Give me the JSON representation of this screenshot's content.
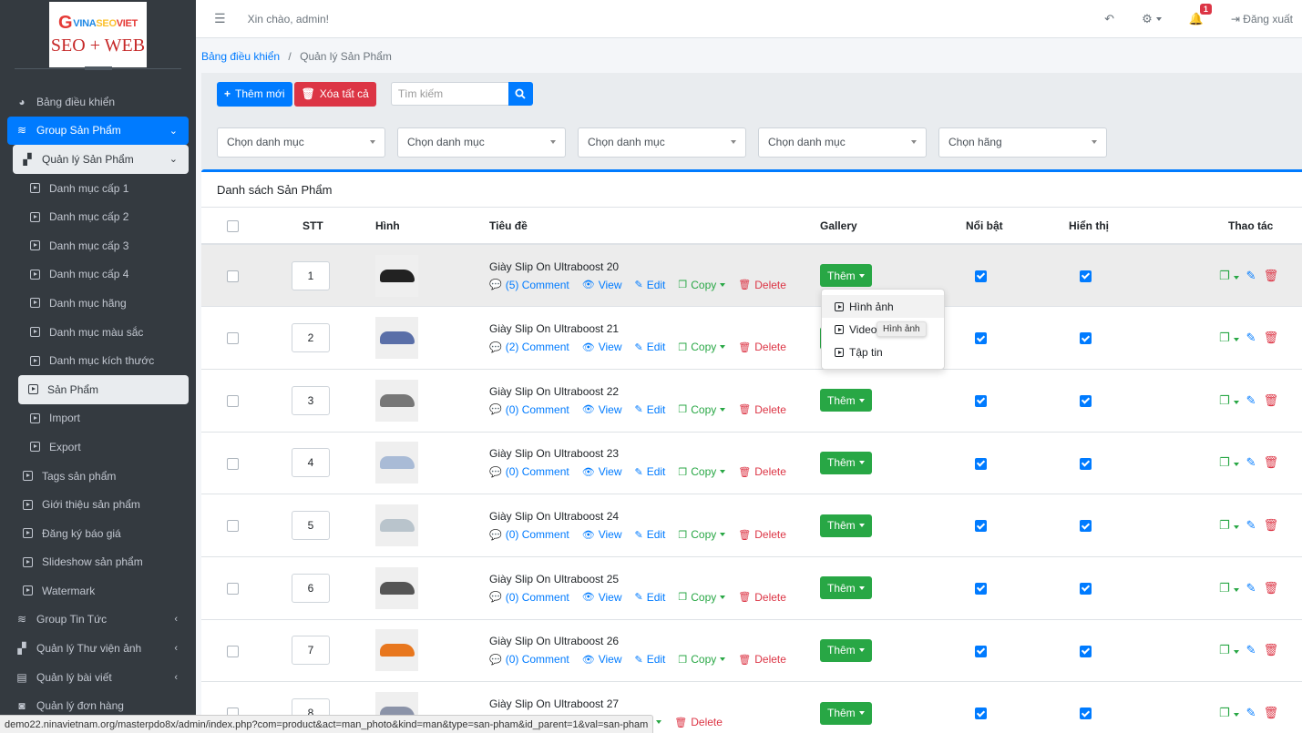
{
  "logo": {
    "top_g": "G",
    "top_a": "VINA",
    "top_b": "SEO",
    "top_c": "VIET",
    "bottom": "SEO + WEB"
  },
  "sidebar": {
    "items": [
      {
        "label": "Bảng điều khiển"
      },
      {
        "label": "Group Sản Phẩm"
      },
      {
        "label": "Quản lý Sản Phẩm"
      },
      {
        "label": "Danh mục cấp 1"
      },
      {
        "label": "Danh mục cấp 2"
      },
      {
        "label": "Danh mục cấp 3"
      },
      {
        "label": "Danh mục cấp 4"
      },
      {
        "label": "Danh mục hãng"
      },
      {
        "label": "Danh mục màu sắc"
      },
      {
        "label": "Danh mục kích thước"
      },
      {
        "label": "Sản Phẩm"
      },
      {
        "label": "Import"
      },
      {
        "label": "Export"
      },
      {
        "label": "Tags sản phẩm"
      },
      {
        "label": "Giới thiệu sản phẩm"
      },
      {
        "label": "Đăng ký báo giá"
      },
      {
        "label": "Slideshow sản phẩm"
      },
      {
        "label": "Watermark"
      },
      {
        "label": "Group Tin Tức"
      },
      {
        "label": "Quản lý Thư viện ảnh"
      },
      {
        "label": "Quản lý bài viết"
      },
      {
        "label": "Quản lý đơn hàng"
      }
    ]
  },
  "topbar": {
    "greeting": "Xin chào, admin!",
    "notification_count": "1",
    "logout": "Đăng xuất"
  },
  "breadcrumb": {
    "home": "Bảng điều khiển",
    "sep": "/",
    "current": "Quản lý Sản Phẩm"
  },
  "toolbar": {
    "add_label": "Thêm mới",
    "delete_all_label": "Xóa tất cả",
    "search_placeholder": "Tìm kiếm"
  },
  "filters": [
    "Chọn danh mục",
    "Chọn danh mục",
    "Chọn danh mục",
    "Chọn danh mục",
    "Chọn hãng"
  ],
  "card": {
    "title": "Danh sách Sản Phẩm",
    "columns": {
      "stt": "STT",
      "image": "Hình",
      "title": "Tiêu đề",
      "gallery": "Gallery",
      "featured": "Nổi bật",
      "visible": "Hiển thị",
      "actions": "Thao tác"
    },
    "action_labels": {
      "view": "View",
      "edit": "Edit",
      "copy": "Copy",
      "delete": "Delete",
      "gallery_add": "Thêm"
    },
    "rows": [
      {
        "stt": "1",
        "title": "Giày Slip On Ultraboost 20",
        "comment": "(5) Comment"
      },
      {
        "stt": "2",
        "title": "Giày Slip On Ultraboost 21",
        "comment": "(2) Comment"
      },
      {
        "stt": "3",
        "title": "Giày Slip On Ultraboost 22",
        "comment": "(0) Comment"
      },
      {
        "stt": "4",
        "title": "Giày Slip On Ultraboost 23",
        "comment": "(0) Comment"
      },
      {
        "stt": "5",
        "title": "Giày Slip On Ultraboost 24",
        "comment": "(0) Comment"
      },
      {
        "stt": "6",
        "title": "Giày Slip On Ultraboost 25",
        "comment": "(0) Comment"
      },
      {
        "stt": "7",
        "title": "Giày Slip On Ultraboost 26",
        "comment": "(0) Comment"
      },
      {
        "stt": "8",
        "title": "Giày Slip On Ultraboost 27",
        "comment": ""
      }
    ]
  },
  "gallery_dropdown": {
    "items": [
      "Hình ảnh",
      "Video",
      "Tập tin"
    ],
    "tooltip": "Hình ảnh"
  },
  "status_url": "demo22.ninavietnam.org/masterpdo8x/admin/index.php?com=product&act=man_photo&kind=man&type=san-pham&id_parent=1&val=san-pham",
  "colors": {
    "primary": "#007bff",
    "danger": "#dc3545",
    "success": "#28a745",
    "sidebar": "#343a40"
  }
}
